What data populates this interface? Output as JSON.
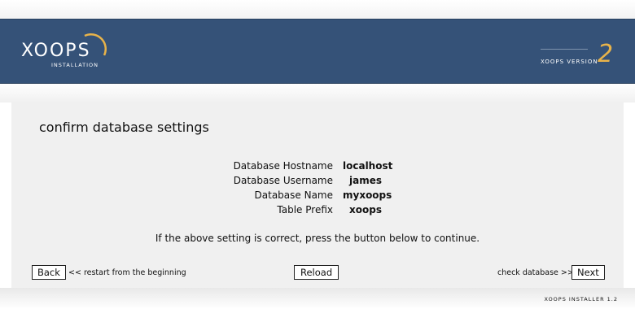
{
  "header": {
    "logo_text": "XOOPS",
    "logo_subtitle": "INSTALLATION",
    "version_label": "XOOPS VERSION",
    "version_number": "2"
  },
  "page": {
    "title": "confirm database settings",
    "settings": [
      {
        "label": "Database Hostname",
        "value": "localhost"
      },
      {
        "label": "Database Username",
        "value": "james"
      },
      {
        "label": "Database Name",
        "value": "myxoops"
      },
      {
        "label": "Table Prefix",
        "value": "xoops"
      }
    ],
    "instruction": "If the above setting is correct, press the button below to continue."
  },
  "nav": {
    "back_label": "Back",
    "back_hint": "<< restart from the beginning",
    "reload_label": "Reload",
    "next_hint": "check database >>",
    "next_label": "Next"
  },
  "footer": {
    "text": "XOOPS INSTALLER 1.2"
  },
  "colors": {
    "header_bg": "#355278",
    "accent": "#e8b34a",
    "content_bg": "#f0f0f0"
  }
}
